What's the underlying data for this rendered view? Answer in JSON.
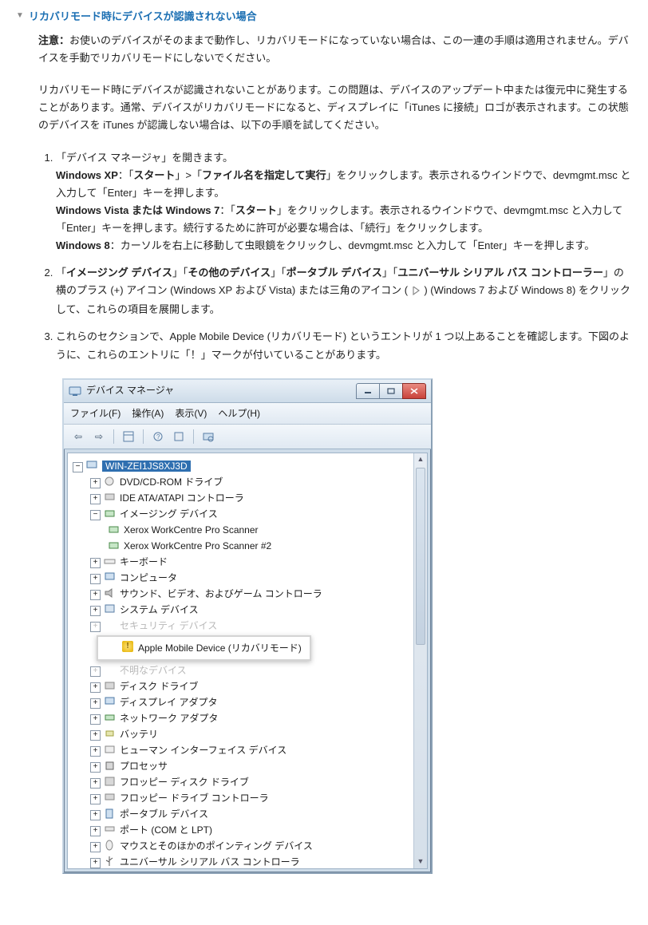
{
  "disclosure": {
    "title": "リカバリモード時にデバイスが認識されない場合"
  },
  "note": {
    "label": "注意：",
    "text": "お使いのデバイスがそのままで動作し、リカバリモードになっていない場合は、この一連の手順は適用されません。デバイスを手動でリカバリモードにしないでください。"
  },
  "intro": "リカバリモード時にデバイスが認識されないことがあります。この問題は、デバイスのアップデート中または復元中に発生することがあります。通常、デバイスがリカバリモードになると、ディスプレイに「iTunes に接続」ロゴが表示されます。この状態のデバイスを iTunes が認識しない場合は、以下の手順を試してください。",
  "steps": {
    "s1_line1": "「デバイス マネージャ」を開きます。",
    "s1_xp_prefix": "Windows XP",
    "s1_xp_sep": "：「",
    "s1_xp_b1": "スタート",
    "s1_xp_mid": "」>「",
    "s1_xp_b2": "ファイル名を指定して実行",
    "s1_xp_tail": "」をクリックします。表示されるウインドウで、devmgmt.msc と入力して「Enter」キーを押します。",
    "s1_vista_prefix": "Windows Vista または Windows 7",
    "s1_vista_sep": "：「",
    "s1_vista_b1": "スタート",
    "s1_vista_tail": "」をクリックします。表示されるウインドウで、devmgmt.msc と入力して「Enter」キーを押します。続行するために許可が必要な場合は、「続行」をクリックします。",
    "s1_w8_prefix": "Windows 8",
    "s1_w8_tail": "：カーソルを右上に移動して虫眼鏡をクリックし、devmgmt.msc と入力して「Enter」キーを押します。",
    "s2_pre": "「",
    "s2_b1": "イメージング デバイス",
    "s2_m1": "」「",
    "s2_b2": "その他のデバイス",
    "s2_m2": "」「",
    "s2_b3": "ポータブル デバイス",
    "s2_m3": "」「",
    "s2_b4": "ユニバーサル シリアル バス コントローラー",
    "s2_tail1": "」の横のプラス (+) アイコン (Windows XP および Vista) または三角のアイコン ( ",
    "s2_tail2": " ) (Windows 7 および Windows 8) をクリックして、これらの項目を展開します。",
    "s3": "これらのセクションで、Apple Mobile Device (リカバリモード) というエントリが 1 つ以上あることを確認します。下図のように、これらのエントリに「！」マークが付いていることがあります。"
  },
  "devmgr": {
    "title": "デバイス マネージャ",
    "menu": {
      "file": "ファイル(F)",
      "action": "操作(A)",
      "view": "表示(V)",
      "help": "ヘルプ(H)"
    },
    "root": "WIN-ZEI1JS8XJ3D",
    "items": [
      "DVD/CD-ROM ドライブ",
      "IDE ATA/ATAPI コントローラ",
      "イメージング デバイス",
      "キーボード",
      "コンピュータ",
      "サウンド、ビデオ、およびゲーム コントローラ",
      "システム デバイス",
      "セキュリティ デバイス",
      "不明なデバイス",
      "ディスク ドライブ",
      "ディスプレイ アダプタ",
      "ネットワーク アダプタ",
      "バッテリ",
      "ヒューマン インターフェイス デバイス",
      "プロセッサ",
      "フロッピー ディスク ドライブ",
      "フロッピー ドライブ コントローラ",
      "ポータブル デバイス",
      "ポート (COM と LPT)",
      "マウスとそのほかのポインティング デバイス",
      "ユニバーサル シリアル バス コントローラ"
    ],
    "imaging_children": [
      "Xerox WorkCentre Pro Scanner",
      "Xerox WorkCentre Pro Scanner #2"
    ],
    "highlight": "Apple Mobile Device (リカバリモード)"
  }
}
